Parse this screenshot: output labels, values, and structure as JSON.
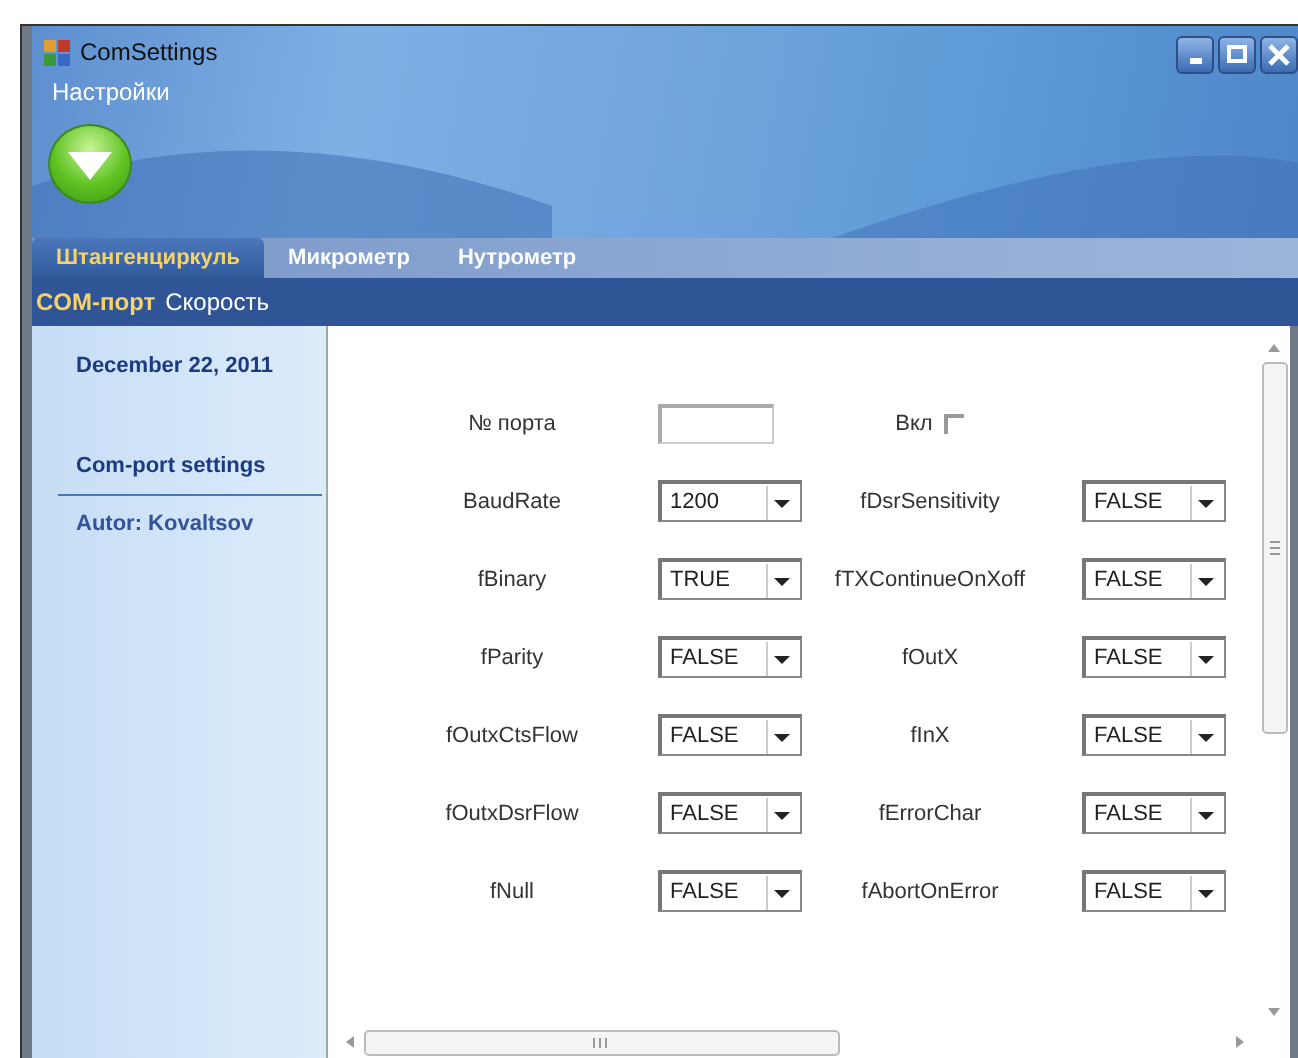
{
  "window": {
    "title": "ComSettings"
  },
  "menu": [
    "Настройки"
  ],
  "tabs": [
    {
      "label": "Штангенциркуль",
      "selected": true
    },
    {
      "label": "Микрометр",
      "selected": false
    },
    {
      "label": "Нутрометр",
      "selected": false
    }
  ],
  "subtabs": [
    {
      "label": "COM-порт",
      "selected": true
    },
    {
      "label": "Скорость",
      "selected": false
    }
  ],
  "sidebar": {
    "date": "December 22, 2011",
    "heading": "Com-port settings",
    "author": "Autor: Kovaltsov"
  },
  "form": {
    "port": {
      "label": "№ порта"
    },
    "enable": {
      "label": "Вкл",
      "checked": false
    },
    "rows": [
      {
        "left": {
          "label": "BaudRate",
          "value": "1200"
        },
        "right": {
          "label": "fDsrSensitivity",
          "value": "FALSE"
        }
      },
      {
        "left": {
          "label": "fBinary",
          "value": "TRUE"
        },
        "right": {
          "label": "fTXContinueOnXoff",
          "value": "FALSE"
        }
      },
      {
        "left": {
          "label": "fParity",
          "value": "FALSE"
        },
        "right": {
          "label": "fOutX",
          "value": "FALSE"
        }
      },
      {
        "left": {
          "label": "fOutxCtsFlow",
          "value": "FALSE"
        },
        "right": {
          "label": "fInX",
          "value": "FALSE"
        }
      },
      {
        "left": {
          "label": "fOutxDsrFlow",
          "value": "FALSE"
        },
        "right": {
          "label": "fErrorChar",
          "value": "FALSE"
        }
      },
      {
        "left": {
          "label": "fNull",
          "value": "FALSE"
        },
        "right": {
          "label": "fAbortOnError",
          "value": "FALSE"
        }
      }
    ]
  }
}
